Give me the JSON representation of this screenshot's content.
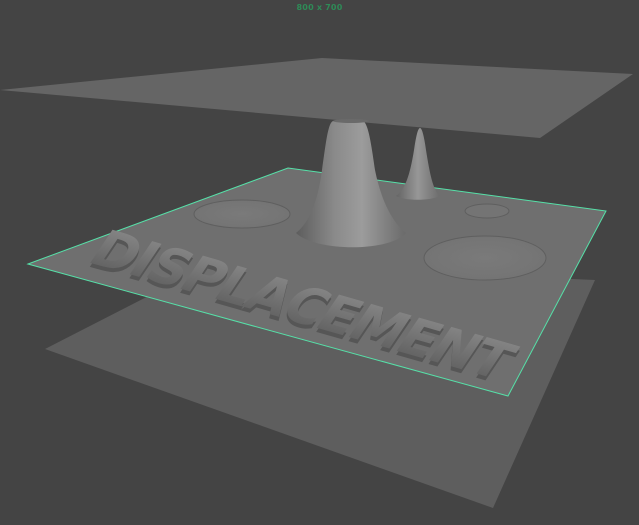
{
  "viewport": {
    "resolution_gate": "800 x 700",
    "background_color": "#444444",
    "selection_outline_color": "#56e0a8",
    "plane_color": "#6e6e6e",
    "objects": [
      {
        "name": "top-plane",
        "selected": false
      },
      {
        "name": "displacement-plane",
        "selected": true
      },
      {
        "name": "bottom-plane",
        "selected": false
      }
    ],
    "displacement_text": "DISPLACEMENT"
  }
}
